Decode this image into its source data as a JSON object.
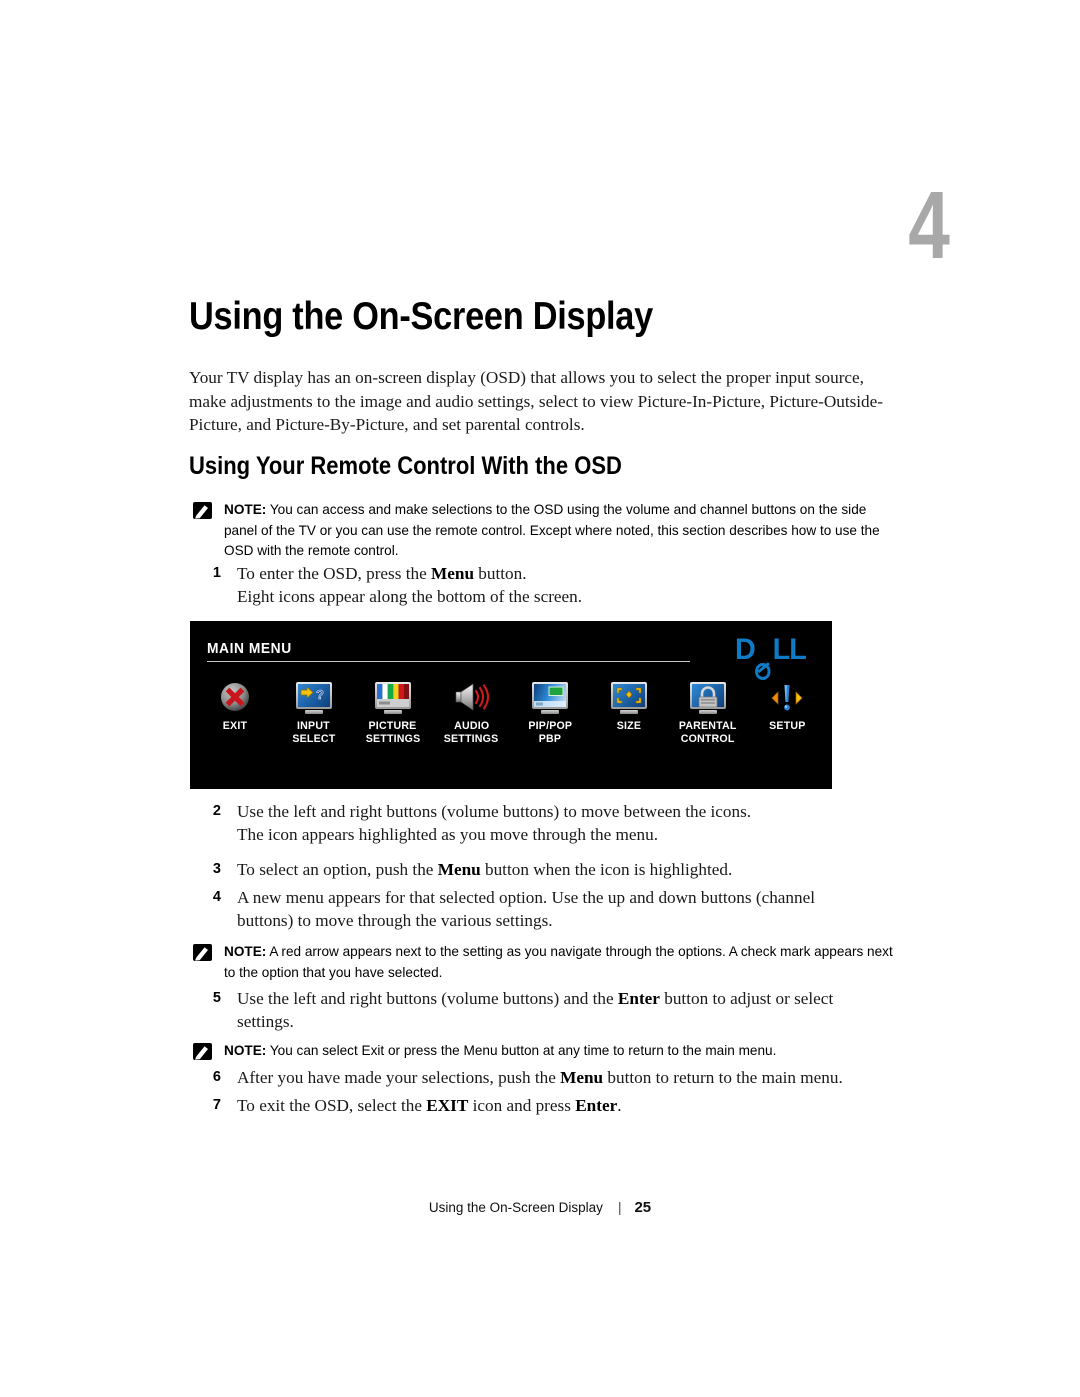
{
  "document": {
    "chapter_number": "4",
    "chapter_title": "Using the On-Screen Display",
    "intro_paragraph": "Your TV display has an on-screen display (OSD) that allows you to select the proper input source, make adjustments to the image and audio settings, select to view Picture-In-Picture, Picture-Outside-Picture, and Picture-By-Picture, and set parental controls.",
    "section_title": "Using Your Remote Control With the OSD"
  },
  "notes": {
    "label": "NOTE:",
    "note1": "You can access and make selections to the OSD using the volume and channel buttons on the side panel of the TV or you can use the remote control. Except where noted, this section describes how to use the OSD with the remote control.",
    "note2": "A red arrow appears next to the setting as you navigate through the options. A check mark appears next to the option that you have selected.",
    "note3": "You can select Exit or press the Menu button at any time to return to the main menu."
  },
  "steps": {
    "s1_num": "1",
    "s1_a": "To enter the OSD, press the ",
    "s1_b": "Menu",
    "s1_c": " button.",
    "s1_sub": "Eight icons appear along the bottom of the screen.",
    "s2_num": "2",
    "s2_text": "Use the left and right buttons (volume buttons) to move between the icons.",
    "s2_sub": "The icon appears highlighted as you move through the menu.",
    "s3_num": "3",
    "s3_a": "To select an option, push the ",
    "s3_b": "Menu",
    "s3_c": " button when the icon is highlighted.",
    "s4_num": "4",
    "s4_text": "A new menu appears for that selected option. Use the up and down buttons (channel buttons) to move through the various settings.",
    "s5_num": "5",
    "s5_a": "Use the left and right buttons (volume buttons) and the ",
    "s5_b": "Enter",
    "s5_c": " button to adjust or select settings.",
    "s6_num": "6",
    "s6_a": "After you have made your selections, push the ",
    "s6_b": "Menu",
    "s6_c": " button to return to the main menu.",
    "s7_num": "7",
    "s7_a": "To exit the OSD, select the ",
    "s7_b": "EXIT",
    "s7_c": " icon and press ",
    "s7_d": "Enter",
    "s7_e": "."
  },
  "osd": {
    "title": "MAIN MENU",
    "brand": "D",
    "brand_tail": "LL",
    "colors": {
      "background": "#000000",
      "dell_blue": "#0f7bc4",
      "rule": "#c9c9c9",
      "label_text": "#ffffff",
      "exit_red": "#c8161d",
      "accent_yellow": "#f5c20a",
      "screen_blue": "#1a63b0"
    },
    "items": [
      {
        "icon": "exit-icon",
        "line1": "EXIT",
        "line2": ""
      },
      {
        "icon": "input-select-icon",
        "line1": "INPUT",
        "line2": "SELECT"
      },
      {
        "icon": "picture-settings-icon",
        "line1": "PICTURE",
        "line2": "SETTINGS"
      },
      {
        "icon": "audio-settings-icon",
        "line1": "AUDIO",
        "line2": "SETTINGS"
      },
      {
        "icon": "pip-pop-pbp-icon",
        "line1": "PIP/POP",
        "line2": "PBP"
      },
      {
        "icon": "size-icon",
        "line1": "SIZE",
        "line2": ""
      },
      {
        "icon": "parental-control-icon",
        "line1": "PARENTAL",
        "line2": "CONTROL"
      },
      {
        "icon": "setup-icon",
        "line1": "SETUP",
        "line2": ""
      }
    ]
  },
  "footer": {
    "running_head": "Using the On-Screen Display",
    "separator": "|",
    "page_number": "25"
  }
}
